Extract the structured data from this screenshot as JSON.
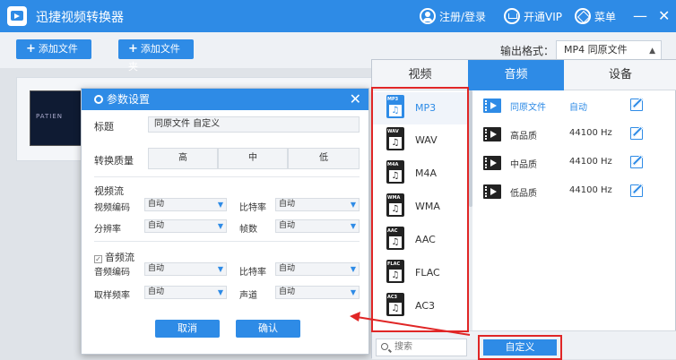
{
  "app": {
    "title": "迅捷视频转换器",
    "login": "注册/登录",
    "vip": "开通VIP",
    "menu": "菜单",
    "minimize": "—",
    "close": "✕"
  },
  "toolbar": {
    "add_file": "添加文件",
    "add_folder": "添加文件夹",
    "output_label": "输出格式：",
    "output_value": "MP4  同原文件"
  },
  "file": {
    "thumb_text": "PATIEN"
  },
  "dialog": {
    "title": "参数设置",
    "title_label": "标题",
    "title_value": "同原文件 自定义",
    "quality_label": "转换质量",
    "quality": [
      "高",
      "中",
      "低"
    ],
    "video_section": "视频流",
    "video": {
      "codec_label": "视频编码",
      "codec_value": "自动",
      "bitrate_label": "比特率",
      "bitrate_value": "自动",
      "res_label": "分辨率",
      "res_value": "自动",
      "fps_label": "帧数",
      "fps_value": "自动"
    },
    "audio_section": "音频流",
    "audio_check": "✓",
    "audio": {
      "codec_label": "音频编码",
      "codec_value": "自动",
      "bitrate_label": "比特率",
      "bitrate_value": "自动",
      "rate_label": "取样频率",
      "rate_value": "自动",
      "channel_label": "声道",
      "channel_value": "自动"
    },
    "cancel": "取消",
    "confirm": "确认"
  },
  "panel": {
    "tabs": [
      "视频",
      "音频",
      "设备"
    ],
    "formats": [
      {
        "badge": "MP3",
        "name": "MP3"
      },
      {
        "badge": "WAV",
        "name": "WAV"
      },
      {
        "badge": "M4A",
        "name": "M4A"
      },
      {
        "badge": "WMA",
        "name": "WMA"
      },
      {
        "badge": "AAC",
        "name": "AAC"
      },
      {
        "badge": "FLAC",
        "name": "FLAC"
      },
      {
        "badge": "AC3",
        "name": "AC3"
      }
    ],
    "presets": [
      {
        "name": "同原文件",
        "value": "自动"
      },
      {
        "name": "高品质",
        "value": "44100 Hz"
      },
      {
        "name": "中品质",
        "value": "44100 Hz"
      },
      {
        "name": "低品质",
        "value": "44100 Hz"
      }
    ],
    "search_placeholder": "搜索",
    "custom": "自定义"
  },
  "colors": {
    "accent": "#2e8be6",
    "highlight": "#e02626"
  }
}
